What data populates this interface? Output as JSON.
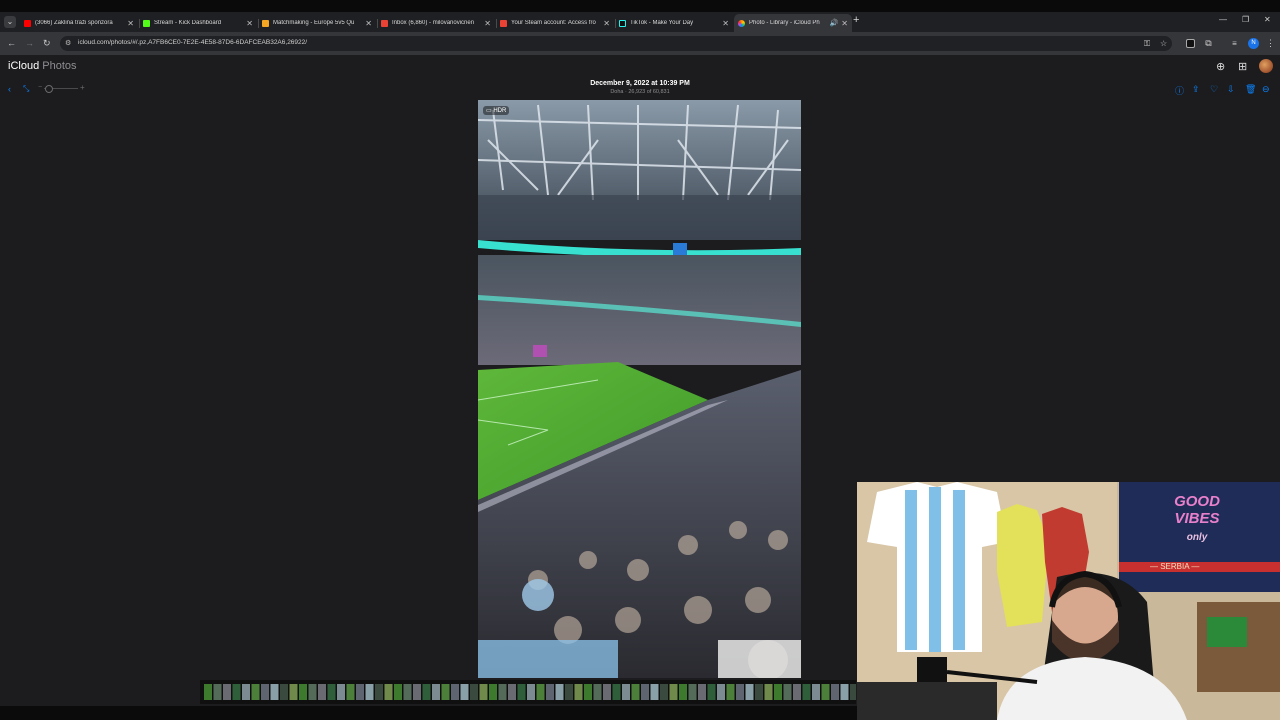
{
  "browser": {
    "tabs": [
      {
        "title": "(3066) Žaklina traži sponzora",
        "favicon_color": "#ff0000",
        "icon": "youtube-icon"
      },
      {
        "title": "Stream - Kick Dashboard",
        "favicon_color": "#53fc18",
        "icon": "kick-icon"
      },
      {
        "title": "Matchmaking - Europe 5v5 Qu",
        "favicon_color": "#f5a623",
        "icon": "faceit-icon"
      },
      {
        "title": "Inbox (6,860) - milovanovicnen",
        "favicon_color": "#ea4335",
        "icon": "gmail-icon"
      },
      {
        "title": "Your Steam account: Access fro",
        "favicon_color": "#ea4335",
        "icon": "gmail-icon"
      },
      {
        "title": "TikTok - Make Your Day",
        "favicon_color": "#111111",
        "icon": "tiktok-icon"
      },
      {
        "title": "Photo - Library - iCloud Ph",
        "favicon_color": "#34c759",
        "icon": "photos-icon",
        "active": true,
        "audio": true
      }
    ],
    "url": "icloud.com/photos/#/.pz,A7FB6CE0-7E2E-4E58-87D6-6DAFCEAB32A6,26922/",
    "profile_initial": "N"
  },
  "app": {
    "brand": "iCloud",
    "product": "Photos"
  },
  "photo": {
    "date": "December 9, 2022 at 10:39 PM",
    "subtitle": "Doha · 26,923 of 60,831",
    "badge": "HDR"
  }
}
